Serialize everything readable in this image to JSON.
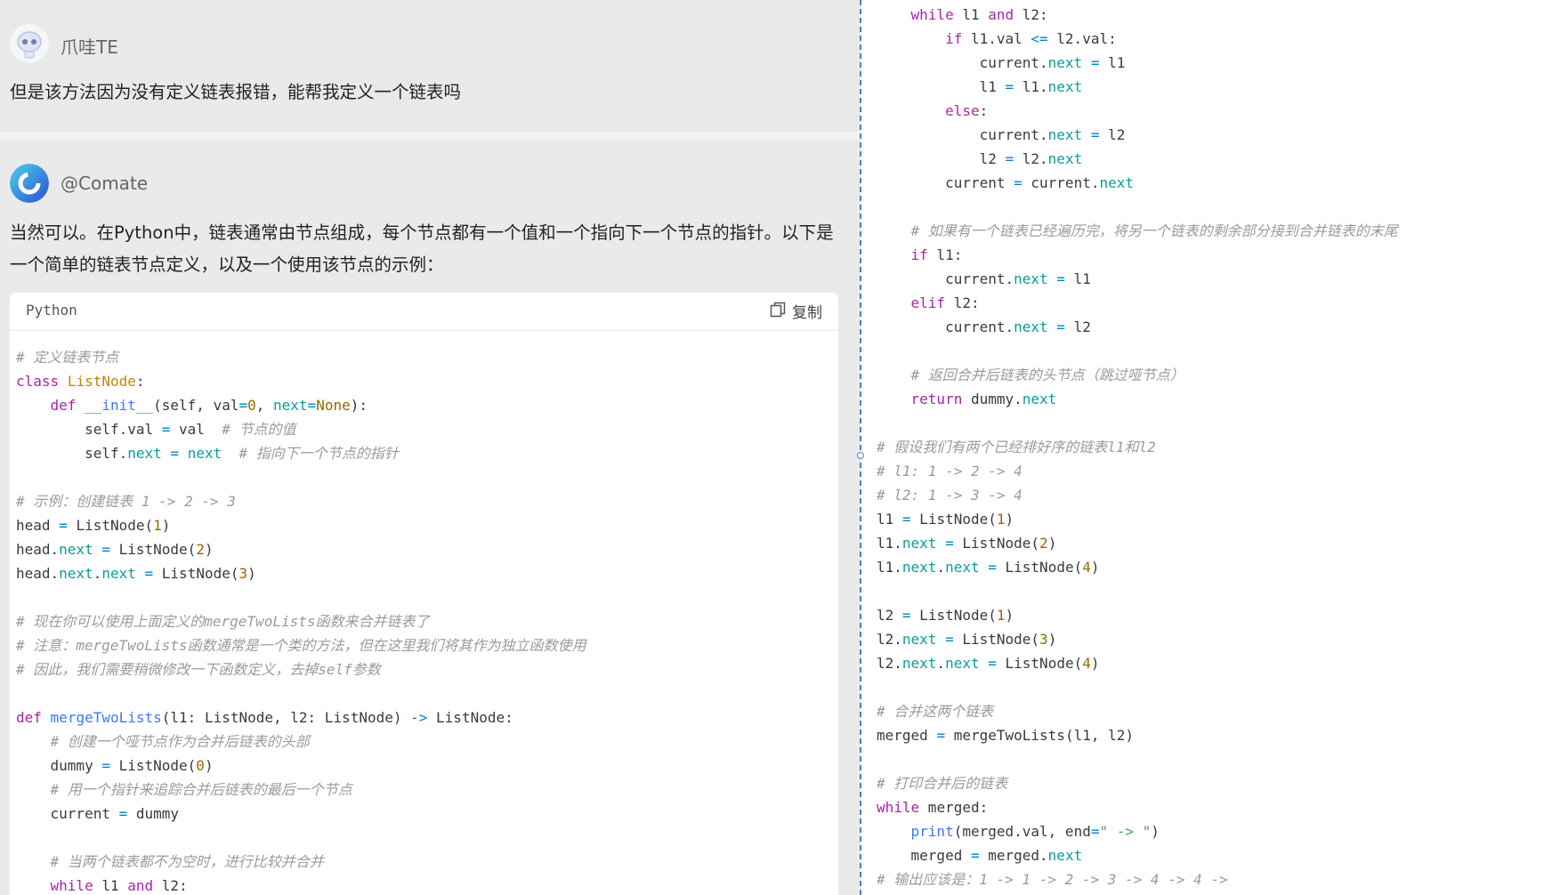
{
  "user_message": {
    "name": "爪哇TE",
    "text": "但是该方法因为没有定义链表报错，能帮我定义一个链表吗"
  },
  "bot_message": {
    "name": "@Comate",
    "text_line1": "当然可以。在Python中，链表通常由节点组成，每个节点都有一个值和一个指向下一个节点的指针。以下是",
    "text_line2": "一个简单的链表节点定义，以及一个使用该节点的示例："
  },
  "code_block": {
    "language": "Python",
    "copy_label": "复制"
  },
  "colors": {
    "keyword": "#a626a4",
    "class_name": "#c18401",
    "function": "#4078f2",
    "attribute": "#0e9a9a",
    "number": "#986801",
    "comment": "#9a9a9a",
    "splitter": "#4a7fd0"
  },
  "icons": [
    "user-avatar-icon",
    "comate-logo-icon",
    "copy-icon"
  ]
}
